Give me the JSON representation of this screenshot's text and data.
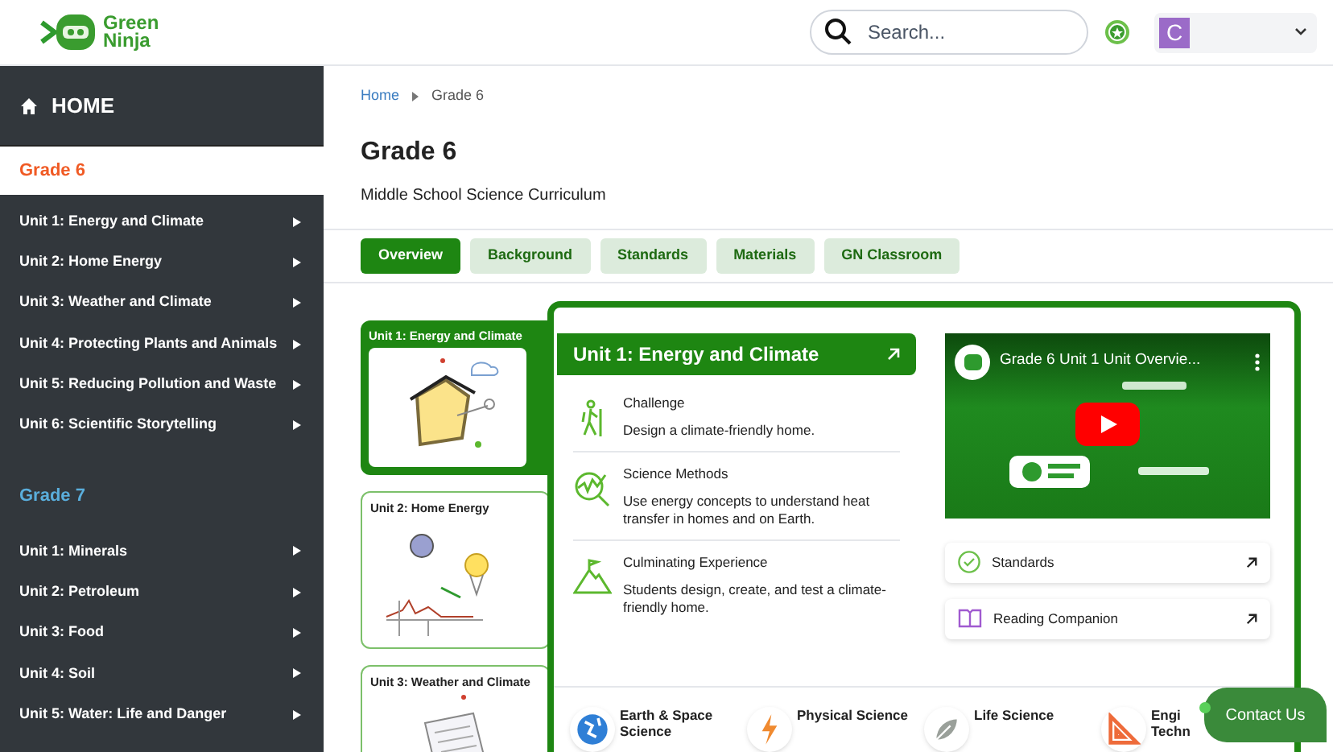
{
  "header": {
    "logo": [
      "Green",
      "Ninja"
    ],
    "search": {
      "placeholder": "Search..."
    },
    "user": {
      "initial": "C"
    }
  },
  "sidebar": {
    "home": "HOME",
    "grades": [
      {
        "title": "Grade 6",
        "selected": true,
        "units": [
          "Unit 1: Energy and Climate",
          "Unit 2: Home Energy",
          "Unit 3: Weather and Climate",
          "Unit 4: Protecting Plants and Animals",
          "Unit 5: Reducing Pollution and Waste",
          "Unit 6: Scientific Storytelling"
        ]
      },
      {
        "title": "Grade 7",
        "selected": false,
        "units": [
          "Unit 1: Minerals",
          "Unit 2: Petroleum",
          "Unit 3: Food",
          "Unit 4: Soil",
          "Unit 5: Water: Life and Danger"
        ]
      }
    ]
  },
  "breadcrumb": [
    "Home",
    "Grade 6"
  ],
  "title": "Grade 6",
  "subtitle": "Middle School Science Curriculum",
  "tabs": [
    {
      "label": "Overview",
      "selected": true
    },
    {
      "label": "Background",
      "selected": false
    },
    {
      "label": "Standards",
      "selected": false
    },
    {
      "label": "Materials",
      "selected": false
    },
    {
      "label": "GN Classroom",
      "selected": false
    }
  ],
  "unit_cards": [
    {
      "title": "Unit 1: Energy and Climate",
      "selected": true,
      "kind": "house"
    },
    {
      "title": "Unit 2: Home Energy",
      "selected": false,
      "kind": "energy"
    },
    {
      "title": "Unit 3: Weather and Climate",
      "selected": false,
      "kind": "weather"
    }
  ],
  "unit_panel": {
    "title": "Unit 1: Energy and Climate",
    "sections": [
      {
        "kind": "challenge",
        "heading": "Challenge",
        "text": "Design a climate-friendly home."
      },
      {
        "kind": "methods",
        "heading": "Science Methods",
        "text": "Use energy concepts to understand heat transfer in homes and on Earth."
      },
      {
        "kind": "experience",
        "heading": "Culminating Experience",
        "text": "Students design, create, and test a climate-friendly home."
      }
    ],
    "video": {
      "title": "Grade 6 Unit 1 Unit Overvie..."
    },
    "links": [
      {
        "kind": "standards",
        "label": "Standards"
      },
      {
        "kind": "reading",
        "label": "Reading Companion"
      }
    ],
    "subjects": [
      {
        "kind": "earth",
        "lines": [
          "Earth & Space",
          "Science"
        ]
      },
      {
        "kind": "physical",
        "lines": [
          "Physical Science"
        ]
      },
      {
        "kind": "life",
        "lines": [
          "Life Science"
        ]
      },
      {
        "kind": "engineering",
        "lines": [
          "Engi",
          "Techn"
        ]
      }
    ]
  },
  "contact": "Contact Us"
}
